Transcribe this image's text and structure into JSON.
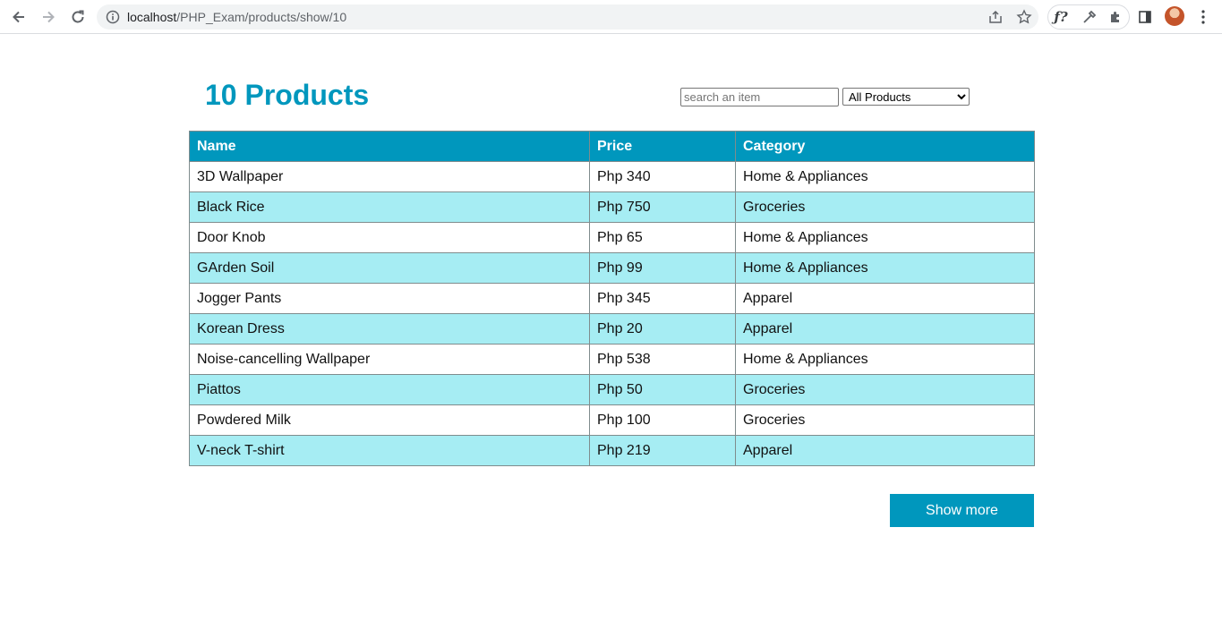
{
  "browser": {
    "url_host": "localhost",
    "url_path": "/PHP_Exam/products/show/10"
  },
  "page": {
    "title": "10 Products"
  },
  "search": {
    "placeholder": "search an item",
    "value": ""
  },
  "category_filter": {
    "selected": "All Products"
  },
  "table": {
    "headers": [
      "Name",
      "Price",
      "Category"
    ],
    "rows": [
      [
        "3D Wallpaper",
        "Php 340",
        "Home & Appliances"
      ],
      [
        "Black Rice",
        "Php 750",
        "Groceries"
      ],
      [
        "Door Knob",
        "Php 65",
        "Home & Appliances"
      ],
      [
        "GArden Soil",
        "Php 99",
        "Home & Appliances"
      ],
      [
        "Jogger Pants",
        "Php 345",
        "Apparel"
      ],
      [
        "Korean Dress",
        "Php 20",
        "Apparel"
      ],
      [
        "Noise-cancelling Wallpaper",
        "Php 538",
        "Home & Appliances"
      ],
      [
        "Piattos",
        "Php 50",
        "Groceries"
      ],
      [
        "Powdered Milk",
        "Php 100",
        "Groceries"
      ],
      [
        "V-neck T-shirt",
        "Php 219",
        "Apparel"
      ]
    ]
  },
  "actions": {
    "show_more_label": "Show more"
  },
  "colors": {
    "accent": "#0097bd",
    "row_alt": "#a6edf3"
  }
}
